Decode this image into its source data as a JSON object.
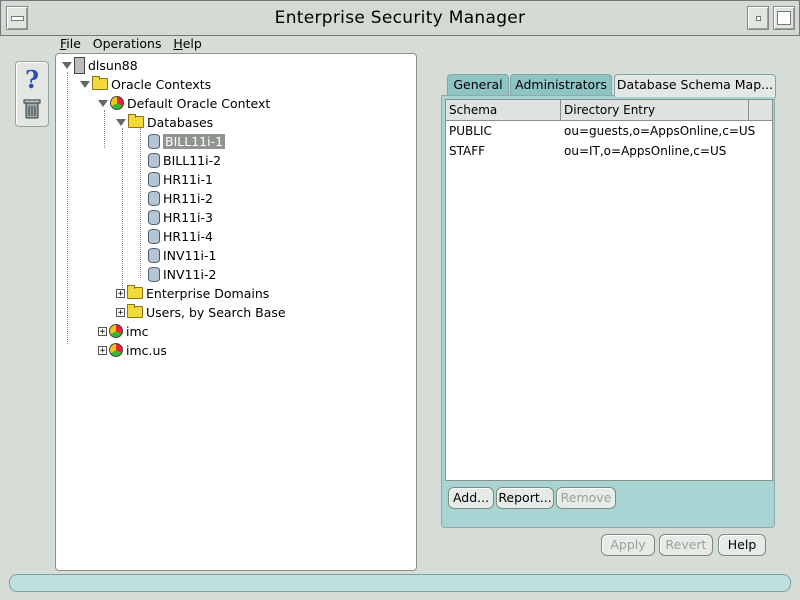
{
  "window": {
    "title": "Enterprise Security Manager"
  },
  "menu": [
    {
      "mnemonic": "F",
      "rest": "ile"
    },
    {
      "mnemonic": "",
      "rest": "Operations"
    },
    {
      "mnemonic": "H",
      "rest": "elp"
    }
  ],
  "toolbar": {
    "help_icon": "question-icon",
    "delete_icon": "trash-icon"
  },
  "tree": {
    "root": "dlsun88",
    "oracle_contexts": "Oracle Contexts",
    "default_context": "Default Oracle Context",
    "databases": "Databases",
    "db_items": [
      "BILL11i-1",
      "BILL11i-2",
      "HR11i-1",
      "HR11i-2",
      "HR11i-3",
      "HR11i-4",
      "INV11i-1",
      "INV11i-2"
    ],
    "enterprise_domains": "Enterprise Domains",
    "users_by_search_base": "Users, by Search Base",
    "imc": "imc",
    "imc_us": "imc.us",
    "selected": "BILL11i-1"
  },
  "tabs": [
    "General",
    "Administrators",
    "Database Schema Map..."
  ],
  "active_tab": "Database Schema Map...",
  "schema_table": {
    "headers": [
      "Schema",
      "Directory Entry"
    ],
    "rows": [
      [
        "PUBLIC",
        "ou=guests,o=AppsOnline,c=US"
      ],
      [
        "STAFF",
        "ou=IT,o=AppsOnline,c=US"
      ]
    ]
  },
  "table_buttons": {
    "add": "Add...",
    "report": "Report...",
    "remove": "Remove"
  },
  "bottom_buttons": {
    "apply": "Apply",
    "revert": "Revert",
    "help": "Help"
  },
  "colors": {
    "tab_inactive": "#8fc4c4",
    "tab_body": "#a9d4d4",
    "selection": "#8f948f",
    "window_bg": "#d6dcd6"
  }
}
